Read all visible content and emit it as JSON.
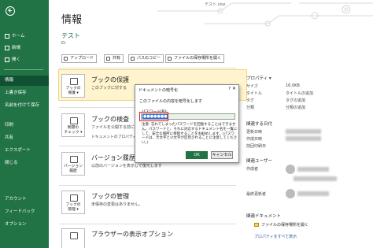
{
  "window": {
    "filename": "テスト.xlsx"
  },
  "sidebar": {
    "items": [
      {
        "label": "ホーム"
      },
      {
        "label": "新規"
      },
      {
        "label": "開く"
      },
      {
        "label": "情報"
      },
      {
        "label": "上書き保存"
      },
      {
        "label": "名前を付けて保存"
      },
      {
        "label": "印刷"
      },
      {
        "label": "共有"
      },
      {
        "label": "エクスポート"
      },
      {
        "label": "閉じる"
      },
      {
        "label": "アカウント"
      },
      {
        "label": "フィードバック"
      },
      {
        "label": "オプション"
      }
    ]
  },
  "main": {
    "page_title": "情報",
    "doc_title": "テスト",
    "doc_path": "D:",
    "toolbar": [
      {
        "label": "アップロード",
        "icon": "upload-icon"
      },
      {
        "label": "共有",
        "icon": "share-icon"
      },
      {
        "label": "パスのコピー",
        "icon": "link-icon"
      },
      {
        "label": "ファイルの保存場所を開く",
        "icon": "folder-icon"
      }
    ],
    "sections": [
      {
        "icon_label": "ブックの保護",
        "icon_caption": "ブックの\n保護 ▾",
        "title": "ブックの保護",
        "desc": "このブックに対する"
      },
      {
        "icon_label": "問題のチェック",
        "icon_caption": "問題の\nチェック ▾",
        "title": "ブックの検査",
        "desc": "ファイルを公開する前に",
        "bullets": [
          "ドキュメントのプロパティ、作成者の名前"
        ]
      },
      {
        "icon_label": "バージョン履歴",
        "icon_caption": "バージョン履歴",
        "title": "バージョン履歴",
        "desc": "以前のバージョンを表示して復元します"
      },
      {
        "icon_label": "ブックの管理",
        "icon_caption": "ブックの\n管理 ▾",
        "title": "ブックの管理",
        "desc": "未保存の変更はありません。"
      },
      {
        "icon_label": "ブラウザーの表示オプション",
        "icon_caption": "",
        "title": "ブラウザーの表示オプション",
        "desc": ""
      }
    ]
  },
  "properties": {
    "heading": "プロパティ ▾",
    "rows": [
      {
        "label": "サイズ",
        "value": "16.0KB"
      },
      {
        "label": "タイトル",
        "value": "タイトルの追加"
      },
      {
        "label": "タグ",
        "value": "タグの追加"
      },
      {
        "label": "分類",
        "value": "分類の追加"
      }
    ],
    "dates_heading": "関連する日付",
    "dates": [
      {
        "label": "更新日時"
      },
      {
        "label": "作成日時"
      },
      {
        "label": "前回印刷日"
      }
    ],
    "users_heading": "関連ユーザー",
    "users": [
      {
        "label": "作成者"
      },
      {
        "label": "最終更新者"
      }
    ],
    "docs_heading": "関連ドキュメント",
    "open_location": "ファイルの保存場所を開く",
    "show_all": "プロパティをすべて表示"
  },
  "dialog": {
    "title": "ドキュメントの暗号化",
    "help": "?",
    "close": "✕",
    "message": "このファイルの内容を暗号化します",
    "password_label": "パスワード(R):",
    "password_value": "●●●●●●●●●",
    "note": "注意: 忘れてしまったパスワードを回復することはできません。パスワードと、それに対応するドキュメント名を一覧にして、安全な場所に保管することをお勧めします。(パスワードは、大文字と小文字が区別されることに注意してください。)",
    "ok_label": "OK",
    "cancel_label": "キャンセル"
  },
  "colors": {
    "accent": "#217346",
    "highlight": "#fff4ce",
    "select": "#2b6fd6",
    "callout": "#e02020"
  }
}
